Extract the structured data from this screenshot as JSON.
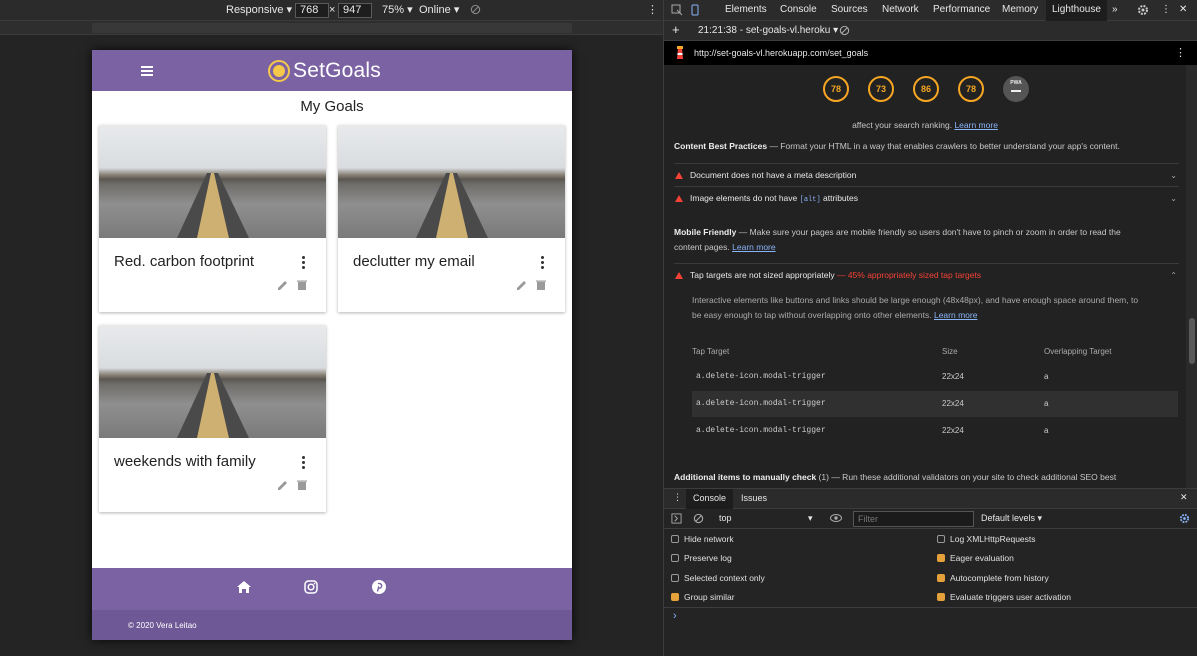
{
  "device_toolbar": {
    "mode": "Responsive",
    "width": "768",
    "times": "×",
    "height": "947",
    "zoom": "75%",
    "network": "Online"
  },
  "site": {
    "logo_text": "SetGoals",
    "page_title": "My Goals",
    "goals": [
      {
        "title": "Red. carbon footprint"
      },
      {
        "title": "declutter my email"
      },
      {
        "title": "weekends with family"
      }
    ],
    "copyright": "© 2020 Vera Leitao",
    "colors": {
      "brand": "#7b62a3",
      "logo_accent": "#f6c84a"
    }
  },
  "devtools": {
    "tabs": [
      "Elements",
      "Console",
      "Sources",
      "Network",
      "Performance",
      "Memory",
      "Lighthouse"
    ],
    "active_tab": "Lighthouse",
    "more_tabs": "»",
    "report_time": "21:21:38 - set-goals-vl.heroku",
    "url": "http://set-goals-vl.herokuapp.com/set_goals",
    "scores": [
      "78",
      "73",
      "86",
      "78"
    ],
    "pwa_label": "PWA",
    "seo_intro": "affect your search ranking.",
    "learn_more": "Learn more",
    "content_best_title": "Content Best Practices",
    "content_best_desc": "— Format your HTML in a way that enables crawlers to better understand your app's content.",
    "audit_meta": "Document does not have a meta description",
    "audit_alt_prefix": "Image elements do not have",
    "audit_alt_code": "[alt]",
    "audit_alt_suffix": "attributes",
    "mobile_title": "Mobile Friendly",
    "mobile_desc": "— Make sure your pages are mobile friendly so users don't have to pinch or zoom in order to read the",
    "mobile_desc2": "content pages.",
    "tap_title": "Tap targets are not sized appropriately",
    "tap_result": "— 45% appropriately sized tap targets",
    "tap_desc": "Interactive elements like buttons and links should be large enough (48x48px), and have enough space around them, to",
    "tap_desc2": "be easy enough to tap without overlapping onto other elements.",
    "table_headers": [
      "Tap Target",
      "Size",
      "Overlapping Target"
    ],
    "table_rows": [
      {
        "target": "a.delete-icon.modal-trigger",
        "size": "22x24",
        "overlap": "a"
      },
      {
        "target": "a.delete-icon.modal-trigger",
        "size": "22x24",
        "overlap": "a"
      },
      {
        "target": "a.delete-icon.modal-trigger",
        "size": "22x24",
        "overlap": "a"
      }
    ],
    "additional_title": "Additional items to manually check",
    "additional_count": "(1)",
    "additional_desc": "— Run these additional validators on your site to check additional SEO best",
    "console_tabs": [
      "Console",
      "Issues"
    ],
    "context": "top",
    "filter_placeholder": "Filter",
    "levels": "Default levels",
    "settings": [
      {
        "label": "Hide network",
        "checked": false
      },
      {
        "label": "Log XMLHttpRequests",
        "checked": false
      },
      {
        "label": "Preserve log",
        "checked": false
      },
      {
        "label": "Eager evaluation",
        "checked": true
      },
      {
        "label": "Selected context only",
        "checked": false
      },
      {
        "label": "Autocomplete from history",
        "checked": true
      },
      {
        "label": "Group similar",
        "checked": true
      },
      {
        "label": "Evaluate triggers user activation",
        "checked": true
      }
    ],
    "prompt": "›",
    "colors": {
      "score": "#f6a623",
      "warn": "#f44336",
      "link": "#8ab4f8",
      "checkbox": "#e5a23b"
    }
  }
}
